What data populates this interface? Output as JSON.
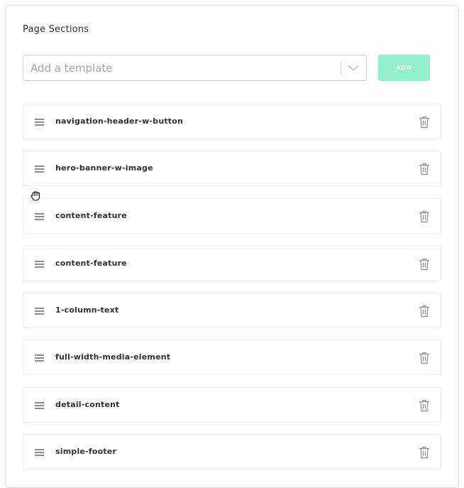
{
  "panel": {
    "title": "Page Sections"
  },
  "template_select": {
    "placeholder": "Add a template",
    "chevron_icon": "chevron-down-icon"
  },
  "add_button": {
    "label": "ADD",
    "color": "#93f0ca"
  },
  "sections": [
    {
      "label": "navigation-header-w-button"
    },
    {
      "label": "hero-banner-w-image"
    },
    {
      "label": "content-feature"
    },
    {
      "label": "content-feature"
    },
    {
      "label": "1-column-text"
    },
    {
      "label": "full-width-media-element"
    },
    {
      "label": "detail-content"
    },
    {
      "label": "simple-footer"
    }
  ],
  "row_icons": {
    "handle": "drag-handle-icon",
    "delete": "trash-icon"
  },
  "cursor": "grab-hand-icon"
}
